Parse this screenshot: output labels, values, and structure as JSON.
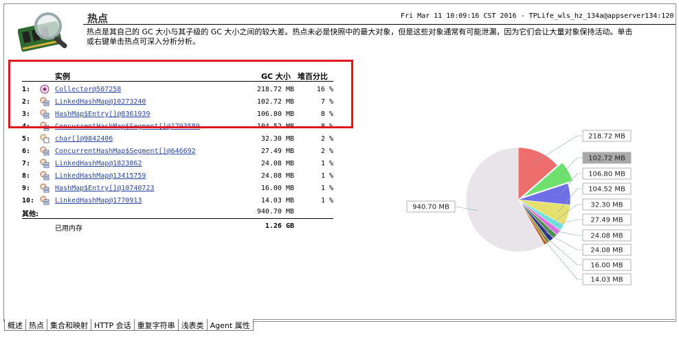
{
  "header": {
    "title": "热点",
    "info": "Fri Mar 11 10:09:16 CST 2016 - TPLife_wls_hz_134a@appserver134:120",
    "description_line1": "热点是其自己的 GC 大小与其子级的 GC 大小之间的较大差。热点未必是快照中的最大对象，但是这些对象通常有可能泄漏，因为它们会让大量对象保持活动。单击",
    "description_line2": "或右键单击热点可深入分析分析。",
    "logo_icon": "memory-magnifier-icon"
  },
  "table": {
    "headers": {
      "instance": "实例",
      "gc_size": "GC 大小",
      "heap_pct": "堆百分比"
    },
    "rows": [
      {
        "num": "1:",
        "name": "Collector@507258",
        "size": "218.72 MB",
        "pct": "16 %",
        "icon": "collector-icon"
      },
      {
        "num": "2:",
        "name": "LinkedHashMap@10273240",
        "size": "102.72 MB",
        "pct": "7 %",
        "icon": "map-icon"
      },
      {
        "num": "3:",
        "name": "HashMap$Entry[]@8361939",
        "size": "106.80 MB",
        "pct": "8 %",
        "icon": "map-icon"
      },
      {
        "num": "4:",
        "name": "ConcurrentHashMap$Segment[]@1793589",
        "size": "104.52 MB",
        "pct": "8 %",
        "icon": "map-icon"
      },
      {
        "num": "5:",
        "name": "char[]@9842406",
        "size": "32.30 MB",
        "pct": "2 %",
        "icon": "array-icon"
      },
      {
        "num": "6:",
        "name": "ConcurrentHashMap$Segment[]@646692",
        "size": "27.49 MB",
        "pct": "2 %",
        "icon": "map-icon"
      },
      {
        "num": "7:",
        "name": "LinkedHashMap@1823862",
        "size": "24.08 MB",
        "pct": "1 %",
        "icon": "map-icon"
      },
      {
        "num": "8:",
        "name": "LinkedHashMap@13415759",
        "size": "24.08 MB",
        "pct": "1 %",
        "icon": "map-icon"
      },
      {
        "num": "9:",
        "name": "HashMap$Entry[]@10740723",
        "size": "16.00 MB",
        "pct": "1 %",
        "icon": "map-icon"
      },
      {
        "num": "10:",
        "name": "LinkedHashMap@1770913",
        "size": "14.03 MB",
        "pct": "1 %",
        "icon": "map-icon"
      }
    ],
    "other_label": "其他:",
    "other_size": "940.70 MB",
    "used_label": "已用内存",
    "used_size": "1.26 GB"
  },
  "chart_data": {
    "type": "pie",
    "slices": [
      {
        "label": "218.72 MB",
        "value": 218.72,
        "color": "#ee6e6e"
      },
      {
        "label": "102.72 MB",
        "value": 102.72,
        "color": "#6ee06e",
        "exploded": true,
        "highlighted": true
      },
      {
        "label": "106.80 MB",
        "value": 106.8,
        "color": "#6e6ee6"
      },
      {
        "label": "104.52 MB",
        "value": 104.52,
        "color": "#e6e06e"
      },
      {
        "label": "32.30 MB",
        "value": 32.3,
        "color": "#6ee0e0"
      },
      {
        "label": "27.49 MB",
        "value": 27.49,
        "color": "#e06ee0"
      },
      {
        "label": "24.08 MB",
        "value": 24.08,
        "color": "#4a8c4a"
      },
      {
        "label": "24.08 MB",
        "value": 24.08,
        "color": "#2e2e8c"
      },
      {
        "label": "16.00 MB",
        "value": 16.0,
        "color": "#8c8c2e"
      },
      {
        "label": "14.03 MB",
        "value": 14.03,
        "color": "#c8541e"
      },
      {
        "label": "940.70 MB",
        "value": 940.7,
        "color": "#e8e4ea"
      }
    ]
  },
  "tabs": [
    {
      "label": "概述",
      "active": false
    },
    {
      "label": "热点",
      "active": true
    },
    {
      "label": "集合和映射",
      "active": false
    },
    {
      "label": "HTTP 会话",
      "active": false
    },
    {
      "label": "重复字符串",
      "active": false
    },
    {
      "label": "浅表类",
      "active": false
    },
    {
      "label": "Agent 属性",
      "active": false
    }
  ],
  "colors": {
    "link": "#2a45a8",
    "highlight_box": "#e0141c",
    "highlight_label_bg": "#a8a8a8"
  }
}
